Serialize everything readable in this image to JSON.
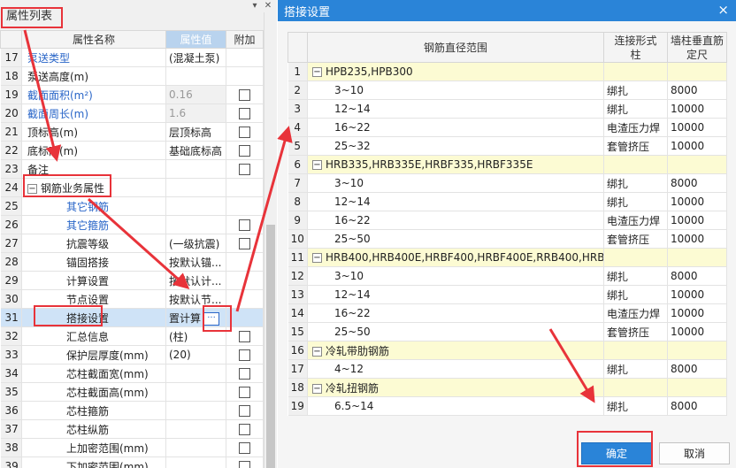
{
  "left_panel": {
    "title": "属性列表",
    "columns": {
      "name": "属性名称",
      "value": "属性值",
      "extra": "附加"
    },
    "rows": [
      {
        "num": "17",
        "name": "泵送类型",
        "value": "(混凝土泵)",
        "blue": true,
        "checkbox": false,
        "gray": false
      },
      {
        "num": "18",
        "name": "泵送高度(m)",
        "value": "",
        "blue": false,
        "checkbox": false,
        "gray": false
      },
      {
        "num": "19",
        "name": "截面面积(m²)",
        "value": "0.16",
        "blue": true,
        "checkbox": true,
        "gray": true
      },
      {
        "num": "20",
        "name": "截面周长(m)",
        "value": "1.6",
        "blue": true,
        "checkbox": true,
        "gray": true
      },
      {
        "num": "21",
        "name": "顶标高(m)",
        "value": "层顶标高",
        "blue": false,
        "checkbox": true,
        "gray": false
      },
      {
        "num": "22",
        "name": "底标高(m)",
        "value": "基础底标高",
        "blue": false,
        "checkbox": true,
        "gray": false
      },
      {
        "num": "23",
        "name": "备注",
        "value": "",
        "blue": false,
        "checkbox": true,
        "gray": false
      },
      {
        "num": "24",
        "name": "钢筋业务属性",
        "value": "",
        "blue": false,
        "checkbox": false,
        "gray": false,
        "group": true,
        "toggle": "−"
      },
      {
        "num": "25",
        "name": "其它钢筋",
        "value": "",
        "blue": true,
        "checkbox": false,
        "gray": false,
        "sub": true
      },
      {
        "num": "26",
        "name": "其它箍筋",
        "value": "",
        "blue": true,
        "checkbox": true,
        "gray": false,
        "sub": true
      },
      {
        "num": "27",
        "name": "抗震等级",
        "value": "(一级抗震)",
        "blue": false,
        "checkbox": true,
        "gray": false,
        "sub": true
      },
      {
        "num": "28",
        "name": "锚固搭接",
        "value": "按默认锚...",
        "blue": false,
        "checkbox": false,
        "gray": false,
        "sub": true
      },
      {
        "num": "29",
        "name": "计算设置",
        "value": "按默认计...",
        "blue": false,
        "checkbox": false,
        "gray": false,
        "sub": true
      },
      {
        "num": "30",
        "name": "节点设置",
        "value": "按默认节...",
        "blue": false,
        "checkbox": false,
        "gray": false,
        "sub": true
      },
      {
        "num": "31",
        "name": "搭接设置",
        "value": "置计算",
        "blue": false,
        "checkbox": false,
        "gray": false,
        "sub": true,
        "selected": true,
        "ellipsis": "···"
      },
      {
        "num": "32",
        "name": "汇总信息",
        "value": "(柱)",
        "blue": false,
        "checkbox": true,
        "gray": false,
        "sub": true
      },
      {
        "num": "33",
        "name": "保护层厚度(mm)",
        "value": "(20)",
        "blue": false,
        "checkbox": true,
        "gray": false,
        "sub": true
      },
      {
        "num": "34",
        "name": "芯柱截面宽(mm)",
        "value": "",
        "blue": false,
        "checkbox": true,
        "gray": false,
        "sub": true
      },
      {
        "num": "35",
        "name": "芯柱截面高(mm)",
        "value": "",
        "blue": false,
        "checkbox": true,
        "gray": false,
        "sub": true
      },
      {
        "num": "36",
        "name": "芯柱箍筋",
        "value": "",
        "blue": false,
        "checkbox": true,
        "gray": false,
        "sub": true
      },
      {
        "num": "37",
        "name": "芯柱纵筋",
        "value": "",
        "blue": false,
        "checkbox": true,
        "gray": false,
        "sub": true
      },
      {
        "num": "38",
        "name": "上加密范围(mm)",
        "value": "",
        "blue": false,
        "checkbox": true,
        "gray": false,
        "sub": true
      },
      {
        "num": "39",
        "name": "下加密范围(mm)",
        "value": "",
        "blue": false,
        "checkbox": true,
        "gray": false,
        "sub": true
      }
    ]
  },
  "dialog": {
    "title": "搭接设置",
    "close_icon": "×",
    "columns": {
      "range": "钢筋直径范围",
      "connect_line1": "连接形式",
      "connect_line2": "柱",
      "length_line1": "墙柱垂直筋",
      "length_line2": "定尺"
    },
    "rows": [
      {
        "num": "1",
        "group": true,
        "toggle": "−",
        "range": "HPB235,HPB300",
        "type": "",
        "length": ""
      },
      {
        "num": "2",
        "group": false,
        "range": "3~10",
        "type": "绑扎",
        "length": "8000"
      },
      {
        "num": "3",
        "group": false,
        "range": "12~14",
        "type": "绑扎",
        "length": "10000"
      },
      {
        "num": "4",
        "group": false,
        "range": "16~22",
        "type": "电渣压力焊",
        "length": "10000"
      },
      {
        "num": "5",
        "group": false,
        "range": "25~32",
        "type": "套管挤压",
        "length": "10000"
      },
      {
        "num": "6",
        "group": true,
        "toggle": "−",
        "range": "HRB335,HRB335E,HRBF335,HRBF335E",
        "type": "",
        "length": ""
      },
      {
        "num": "7",
        "group": false,
        "range": "3~10",
        "type": "绑扎",
        "length": "8000"
      },
      {
        "num": "8",
        "group": false,
        "range": "12~14",
        "type": "绑扎",
        "length": "10000"
      },
      {
        "num": "9",
        "group": false,
        "range": "16~22",
        "type": "电渣压力焊",
        "length": "10000"
      },
      {
        "num": "10",
        "group": false,
        "range": "25~50",
        "type": "套管挤压",
        "length": "10000"
      },
      {
        "num": "11",
        "group": true,
        "toggle": "−",
        "range": "HRB400,HRB400E,HRBF400,HRBF400E,RRB400,HRB...",
        "type": "",
        "length": ""
      },
      {
        "num": "12",
        "group": false,
        "range": "3~10",
        "type": "绑扎",
        "length": "8000"
      },
      {
        "num": "13",
        "group": false,
        "range": "12~14",
        "type": "绑扎",
        "length": "10000"
      },
      {
        "num": "14",
        "group": false,
        "range": "16~22",
        "type": "电渣压力焊",
        "length": "10000"
      },
      {
        "num": "15",
        "group": false,
        "range": "25~50",
        "type": "套管挤压",
        "length": "10000"
      },
      {
        "num": "16",
        "group": true,
        "toggle": "−",
        "range": "冷轧带肋钢筋",
        "type": "",
        "length": ""
      },
      {
        "num": "17",
        "group": false,
        "range": "4~12",
        "type": "绑扎",
        "length": "8000"
      },
      {
        "num": "18",
        "group": true,
        "toggle": "−",
        "range": "冷轧扭钢筋",
        "type": "",
        "length": ""
      },
      {
        "num": "19",
        "group": false,
        "range": "6.5~14",
        "type": "绑扎",
        "length": "8000"
      }
    ],
    "ok_label": "确定",
    "cancel_label": "取消"
  },
  "colors": {
    "annotation_red": "#e8333a",
    "titlebar_blue": "#2a84d8",
    "group_row_yellow": "#fcfbd3",
    "selected_row": "#cfe3f7"
  },
  "icons": {
    "pin": "pin-icon",
    "close": "close-icon",
    "collapse": "collapse-icon",
    "ellipsis": "ellipsis-icon",
    "arrow": "arrow-annotation"
  }
}
